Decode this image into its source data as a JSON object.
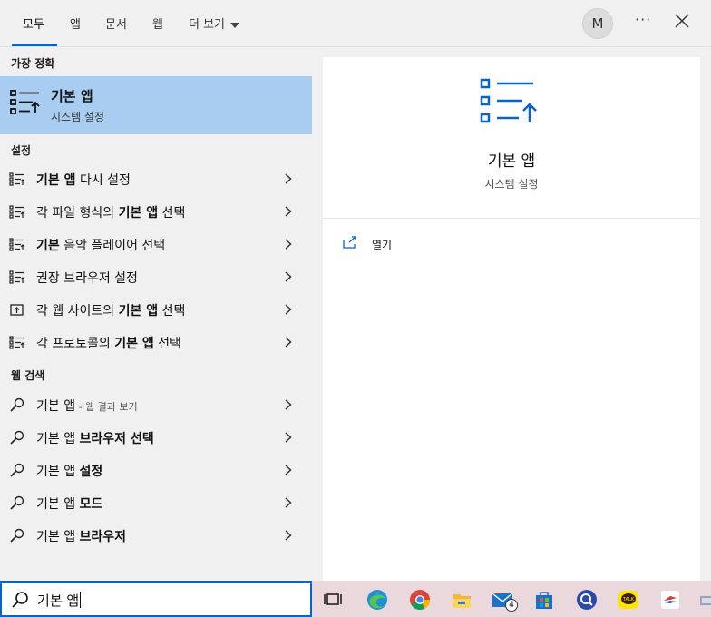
{
  "tabs": [
    {
      "label": "모두"
    },
    {
      "label": "앱"
    },
    {
      "label": "문서"
    },
    {
      "label": "웹"
    },
    {
      "label": "더 보기"
    }
  ],
  "user": {
    "avatar_letter": "M"
  },
  "more_label": "···",
  "best_match": {
    "section": "가장 정확",
    "title": "기본 앱",
    "subtitle": "시스템 설정"
  },
  "settings_section": "설정",
  "settings_items": [
    {
      "pre": "",
      "bold": "기본 앱",
      "post": " 다시 설정",
      "icon": "list-icon"
    },
    {
      "pre": "각 파일 형식의 ",
      "bold": "기본 앱",
      "post": " 선택",
      "icon": "list-icon"
    },
    {
      "pre": "",
      "bold": "기본",
      "post": " 음악 플레이어 선택",
      "icon": "list-icon"
    },
    {
      "pre": "권장 브라우저 설정",
      "bold": "",
      "post": "",
      "icon": "list-icon"
    },
    {
      "pre": "각 웹 사이트의 ",
      "bold": "기본 앱",
      "post": " 선택",
      "icon": "web-app-icon"
    },
    {
      "pre": "각 프로토콜의 ",
      "bold": "기본 앱",
      "post": " 선택",
      "icon": "list-icon"
    }
  ],
  "web_section": "웹 검색",
  "web_items": [
    {
      "pre": "기본 앱",
      "bold": "",
      "sub": " - 웹 결과 보기"
    },
    {
      "pre": "기본 앱 ",
      "bold": "브라우저 선택",
      "sub": ""
    },
    {
      "pre": "기본 앱 ",
      "bold": "설정",
      "sub": ""
    },
    {
      "pre": "기본 앱 ",
      "bold": "모드",
      "sub": ""
    },
    {
      "pre": "기본 앱 ",
      "bold": "브라우저",
      "sub": ""
    }
  ],
  "detail": {
    "title": "기본 앱",
    "subtitle": "시스템 설정",
    "actions": [
      {
        "label": "열기",
        "icon": "open-icon"
      }
    ]
  },
  "search": {
    "value": "기본 앱"
  },
  "taskbar": {
    "mail_badge": "4",
    "apps": [
      "task-view-icon",
      "edge-icon",
      "chrome-icon",
      "file-explorer-icon",
      "mail-icon",
      "store-icon",
      "search-app-icon",
      "kakaotalk-icon",
      "app-icon",
      "app-icon"
    ]
  },
  "colors": {
    "accent": "#0a64c8",
    "selected": "#a9cdf0"
  }
}
